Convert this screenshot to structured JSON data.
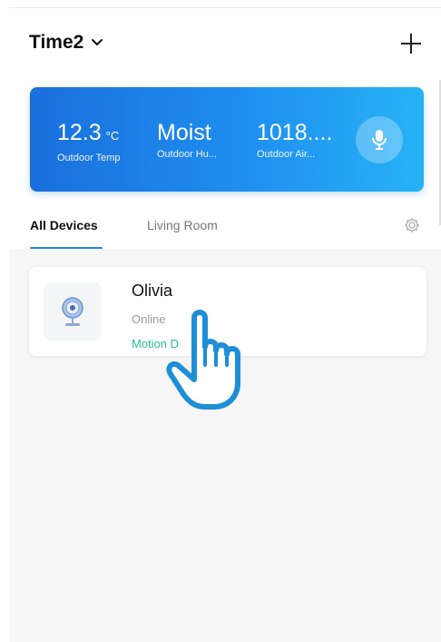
{
  "header": {
    "home_name": "Time2",
    "add_icon": "plus-icon",
    "dropdown_icon": "chevron-down-icon"
  },
  "weather": {
    "temp_value": "12.3",
    "temp_unit": "°C",
    "temp_label": "Outdoor Temp",
    "humidity_value": "Moist",
    "humidity_label": "Outdoor Hu...",
    "air_value": "1018....",
    "air_label": "Outdoor Air...",
    "mic_icon": "microphone-icon"
  },
  "tabs": [
    {
      "label": "All Devices",
      "active": true
    },
    {
      "label": "Living Room",
      "active": false
    }
  ],
  "settings_icon": "gear-icon",
  "devices": [
    {
      "name": "Olivia",
      "status": "Online",
      "sensor": "Motion D",
      "icon": "camera-icon"
    }
  ],
  "colors": {
    "accent": "#1e86ea",
    "card_gradient_start": "#1a6fdc",
    "card_gradient_end": "#27b3f6",
    "sensor_green": "#2bbf93"
  },
  "overlay": {
    "cursor_icon": "pointing-hand-icon"
  }
}
